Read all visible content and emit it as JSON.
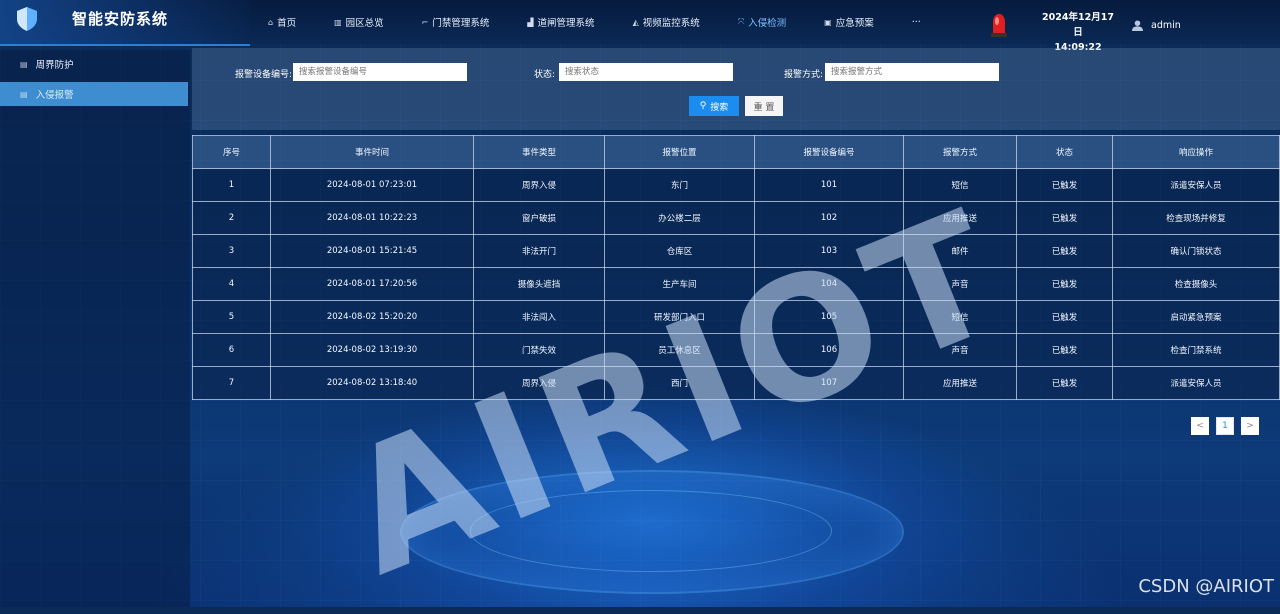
{
  "app": {
    "title": "智能安防系统"
  },
  "nav": {
    "items": [
      {
        "label": "首页",
        "icon": "home-icon"
      },
      {
        "label": "园区总览",
        "icon": "building-icon"
      },
      {
        "label": "门禁管理系统",
        "icon": "key-icon"
      },
      {
        "label": "道闸管理系统",
        "icon": "barrier-icon"
      },
      {
        "label": "视频监控系统",
        "icon": "camera-icon"
      },
      {
        "label": "入侵检测",
        "icon": "detect-icon",
        "active": true
      },
      {
        "label": "应急预案",
        "icon": "emergency-icon"
      },
      {
        "label": "···",
        "icon": "more-icon"
      }
    ]
  },
  "status": {
    "date": "2024年12月17日",
    "time": "14:09:22",
    "user": "admin"
  },
  "sidebar": {
    "items": [
      {
        "label": "周界防护",
        "active": false
      },
      {
        "label": "入侵报警",
        "active": true
      }
    ]
  },
  "search": {
    "device_label": "报警设备编号:",
    "device_placeholder": "搜索报警设备编号",
    "status_label": "状态:",
    "status_placeholder": "搜索状态",
    "method_label": "报警方式:",
    "method_placeholder": "搜索报警方式",
    "search_button": "搜索",
    "reset_button": "重 置"
  },
  "table": {
    "headers": [
      "序号",
      "事件时间",
      "事件类型",
      "报警位置",
      "报警设备编号",
      "报警方式",
      "状态",
      "响应操作"
    ],
    "rows": [
      [
        "1",
        "2024-08-01 07:23:01",
        "周界入侵",
        "东门",
        "101",
        "短信",
        "已触发",
        "派遣安保人员"
      ],
      [
        "2",
        "2024-08-01 10:22:23",
        "窗户破损",
        "办公楼二层",
        "102",
        "应用推送",
        "已触发",
        "检查现场并修复"
      ],
      [
        "3",
        "2024-08-01 15:21:45",
        "非法开门",
        "仓库区",
        "103",
        "邮件",
        "已触发",
        "确认门锁状态"
      ],
      [
        "4",
        "2024-08-01 17:20:56",
        "摄像头遮挡",
        "生产车间",
        "104",
        "声音",
        "已触发",
        "检查摄像头"
      ],
      [
        "5",
        "2024-08-02 15:20:20",
        "非法闯入",
        "研发部门入口",
        "105",
        "短信",
        "已触发",
        "启动紧急预案"
      ],
      [
        "6",
        "2024-08-02 13:19:30",
        "门禁失效",
        "员工休息区",
        "106",
        "声音",
        "已触发",
        "检查门禁系统"
      ],
      [
        "7",
        "2024-08-02 13:18:40",
        "周界入侵",
        "西门",
        "107",
        "应用推送",
        "已触发",
        "派遣安保人员"
      ]
    ]
  },
  "pagination": {
    "prev": "<",
    "current": "1",
    "next": ">"
  },
  "watermark": {
    "brand": "AIRIOT",
    "csdn": "CSDN @AIRIOT"
  },
  "colors": {
    "accent": "#1b8df0",
    "sidebar_active": "#3d8dd0",
    "alarm": "#e02020"
  }
}
